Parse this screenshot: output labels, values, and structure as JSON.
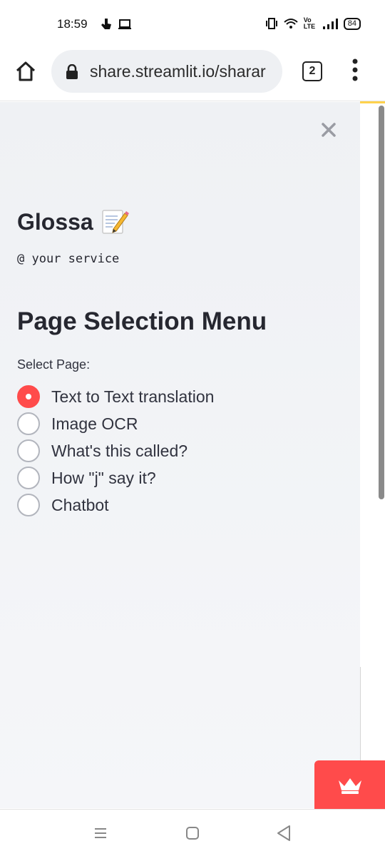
{
  "status_bar": {
    "time": "18:59",
    "network": "Vo LTE",
    "battery": "84"
  },
  "browser": {
    "url": "share.streamlit.io/sharar",
    "tab_count": "2"
  },
  "sidebar": {
    "title": "Glossa",
    "title_icon": "memo-icon",
    "subtitle": "@ your service",
    "heading": "Page Selection Menu",
    "radio_label": "Select Page:",
    "options": [
      {
        "label": "Text to Text translation",
        "selected": true
      },
      {
        "label": "Image OCR",
        "selected": false
      },
      {
        "label": "What's this called?",
        "selected": false
      },
      {
        "label": "How \"j\" say it?",
        "selected": false
      },
      {
        "label": "Chatbot",
        "selected": false
      }
    ]
  },
  "colors": {
    "accent": "#ff4b4b",
    "sidebar_bg": "#f0f2f6",
    "text": "#31333f"
  }
}
